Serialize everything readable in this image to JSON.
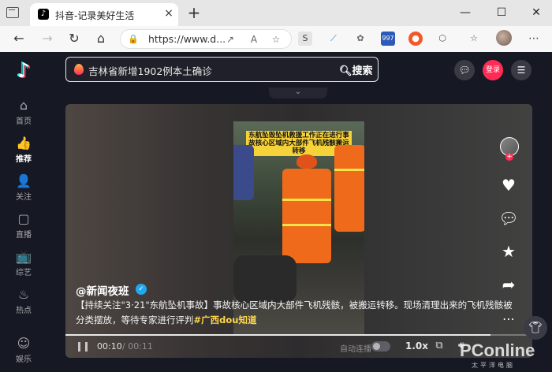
{
  "browser": {
    "tab_title": "抖音-记录美好生活",
    "tab_favicon": "♪",
    "new_tab": "+",
    "close_tab": "×",
    "window_minimize": "—",
    "window_maximize": "☐",
    "window_close": "✕",
    "address_text": "https://www.d...",
    "ext_badge": "997"
  },
  "sidebar": {
    "logo": "♪",
    "items": [
      {
        "label": "首页",
        "icon": "home-icon",
        "glyph": "⌂"
      },
      {
        "label": "推荐",
        "icon": "thumb-up-icon",
        "glyph": "👍"
      },
      {
        "label": "关注",
        "icon": "follow-user-icon",
        "glyph": "👤"
      },
      {
        "label": "直播",
        "icon": "live-tv-icon",
        "glyph": "▢"
      },
      {
        "label": "综艺",
        "icon": "variety-tv-icon",
        "glyph": "📺"
      },
      {
        "label": "热点",
        "icon": "flame-icon",
        "glyph": "♨"
      },
      {
        "label": "娱乐",
        "icon": "smile-icon",
        "glyph": "☺"
      }
    ]
  },
  "header": {
    "search_value": "吉林省新增1902例本土确诊",
    "search_button": "搜索",
    "login_button": "登录",
    "collapse_glyph": "⌄"
  },
  "video": {
    "caption": "东航坠毁坠机救援工作正在进行事故核心区域内大部件飞机残骸搬运转移",
    "author": "@新闻夜班",
    "description": "【持续关注\"3·21\"东航坠机事故】事故核心区域内大部件飞机残骸，被搬运转移。现场清理出来的飞机残骸被分类摆放，等待专家进行评判",
    "hashtag": "#广西dou知道",
    "current_time": "00:10",
    "total_time": "/ 00:11",
    "progress_fraction": 0.91,
    "autoplay_label": "自动连播",
    "speed": "1.0x"
  },
  "watermark": {
    "brand": "PConline",
    "sub": "太平洋电脑"
  }
}
